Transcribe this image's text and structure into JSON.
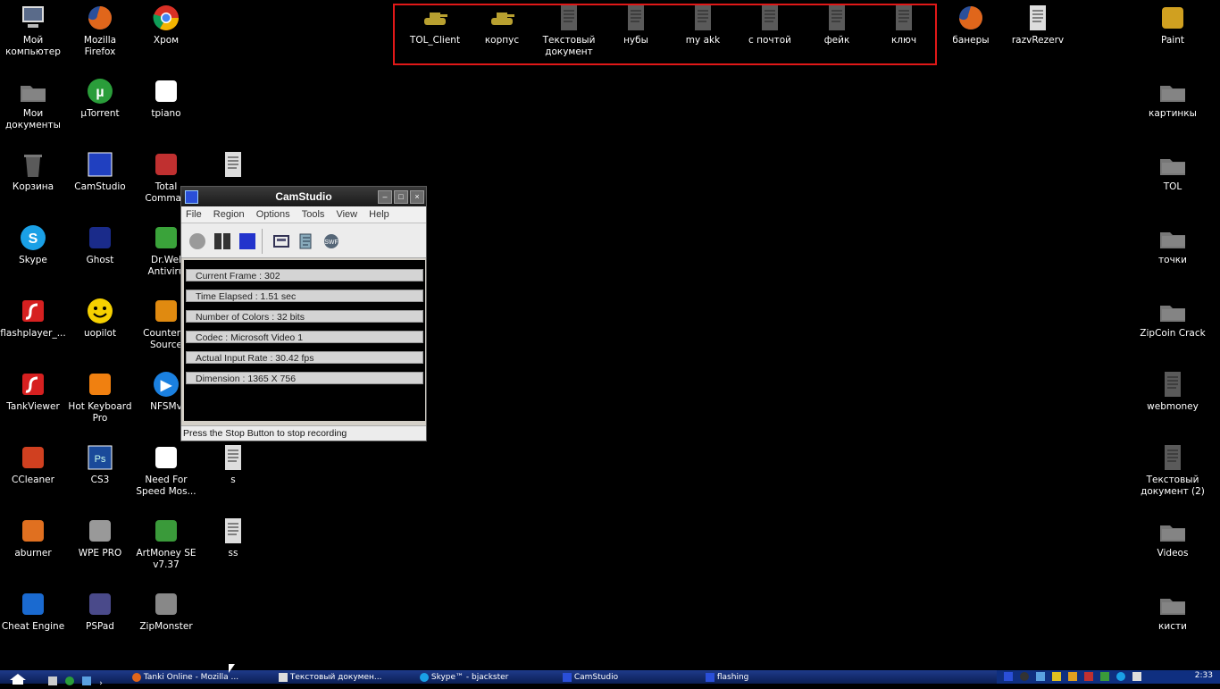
{
  "desktop": {
    "left_icons": [
      {
        "label": "Мой\nкомпьютер",
        "icon": "computer-icon",
        "color": "#5a6b8a"
      },
      {
        "label": "Mozilla Firefox",
        "icon": "firefox-icon",
        "color": "#e0661b"
      },
      {
        "label": "Хром",
        "icon": "chrome-icon",
        "color": "#d93025"
      },
      {
        "label": "Мои\nдокументы",
        "icon": "folder-icon",
        "color": "#777777"
      },
      {
        "label": "µTorrent",
        "icon": "utorrent-icon",
        "color": "#2a9d3a"
      },
      {
        "label": "tpiano",
        "icon": "piano-icon",
        "color": "#ffffff"
      },
      {
        "label": "Корзина",
        "icon": "recycle-bin-icon",
        "color": "#5a5a5a"
      },
      {
        "label": "CamStudio",
        "icon": "camstudio-icon",
        "color": "#2040c0"
      },
      {
        "label": "Total\nComman",
        "icon": "floppy-icon",
        "color": "#c03030"
      },
      {
        "label": "",
        "icon": "document-icon",
        "color": "#dddddd"
      },
      {
        "label": "Skype",
        "icon": "skype-icon",
        "color": "#1aa0e6"
      },
      {
        "label": "Ghost",
        "icon": "ghost-icon",
        "color": "#1a2b8a"
      },
      {
        "label": "Dr.Wel\nAntiviru",
        "icon": "drweb-icon",
        "color": "#3aa33a"
      },
      {
        "label": "flashplayer_...",
        "icon": "flash-icon",
        "color": "#d62020"
      },
      {
        "label": "uopilot",
        "icon": "smiley-icon",
        "color": "#f5d000"
      },
      {
        "label": "Counter-S\nSource",
        "icon": "halflife-icon",
        "color": "#e08a10"
      },
      {
        "label": "TankViewer",
        "icon": "flash-doc-icon",
        "color": "#d62020"
      },
      {
        "label": "Hot Keyboard\nPro",
        "icon": "keyboard-flame-icon",
        "color": "#f08010"
      },
      {
        "label": "NFSMv",
        "icon": "media-player-icon",
        "color": "#1a80e0"
      },
      {
        "label": "CCleaner",
        "icon": "ccleaner-icon",
        "color": "#d04020"
      },
      {
        "label": "CS3",
        "icon": "photoshop-icon",
        "color": "#1a4a9a"
      },
      {
        "label": "Need For\nSpeed Mos...",
        "icon": "nfs-icon",
        "color": "#ffffff"
      },
      {
        "label": "s",
        "icon": "document-icon",
        "color": "#dddddd"
      },
      {
        "label": "aburner",
        "icon": "aburner-icon",
        "color": "#e07020"
      },
      {
        "label": "WPE PRO",
        "icon": "wpe-icon",
        "color": "#999999"
      },
      {
        "label": "ArtMoney SE\nv7.37",
        "icon": "money-icon",
        "color": "#3a9a3a"
      },
      {
        "label": "ss",
        "icon": "document-icon",
        "color": "#dddddd"
      },
      {
        "label": "Cheat Engine",
        "icon": "cheat-engine-icon",
        "color": "#1a6ad0"
      },
      {
        "label": "PSPad",
        "icon": "pspad-icon",
        "color": "#4a4a8a"
      },
      {
        "label": "ZipMonster",
        "icon": "zip-icon",
        "color": "#888888"
      }
    ],
    "top_icons": [
      {
        "label": "TOL_Client",
        "icon": "tank-icon",
        "color": "#b8a030"
      },
      {
        "label": "корпус",
        "icon": "tank-icon",
        "color": "#b8a030"
      },
      {
        "label": "Текстовый\nдокумент",
        "icon": "text-file-icon",
        "color": "#5a5a5a"
      },
      {
        "label": "нубы",
        "icon": "text-file-icon",
        "color": "#5a5a5a"
      },
      {
        "label": "my akk",
        "icon": "text-file-icon",
        "color": "#5a5a5a"
      },
      {
        "label": "с почтой",
        "icon": "text-file-icon",
        "color": "#5a5a5a"
      },
      {
        "label": "фейк",
        "icon": "text-file-icon",
        "color": "#5a5a5a"
      },
      {
        "label": "ключ",
        "icon": "text-file-icon",
        "color": "#5a5a5a"
      },
      {
        "label": "банеры",
        "icon": "firefox-file-icon",
        "color": "#e0661b"
      },
      {
        "label": "razvRezerv",
        "icon": "text-file-icon",
        "color": "#dddddd"
      }
    ],
    "right_icons": [
      {
        "label": "Paint",
        "icon": "paint-icon",
        "color": "#d0a020"
      },
      {
        "label": "картинкы",
        "icon": "folder-icon",
        "color": "#777777"
      },
      {
        "label": "TOL",
        "icon": "folder-icon",
        "color": "#777777"
      },
      {
        "label": "точки",
        "icon": "folder-icon",
        "color": "#777777"
      },
      {
        "label": "ZipCoin Crack",
        "icon": "folder-icon",
        "color": "#777777"
      },
      {
        "label": "webmoney",
        "icon": "text-file-icon",
        "color": "#5a5a5a"
      },
      {
        "label": "Текстовый\nдокумент (2)",
        "icon": "text-file-icon",
        "color": "#5a5a5a"
      },
      {
        "label": "Videos",
        "icon": "folder-icon",
        "color": "#777777"
      },
      {
        "label": "кисти",
        "icon": "folder-icon",
        "color": "#777777"
      }
    ]
  },
  "camstudio": {
    "title": "CamStudio",
    "menu": [
      "File",
      "Region",
      "Options",
      "Tools",
      "View",
      "Help"
    ],
    "stats": [
      "Current Frame : 302",
      "Time Elapsed : 1.51 sec",
      "Number of Colors : 32 bits",
      "Codec : Microsoft Video 1",
      "Actual Input Rate : 30.42 fps",
      "Dimension : 1365 X 756"
    ],
    "status": "Press the Stop Button to stop recording"
  },
  "taskbar": {
    "buttons": [
      "Tanki Online - Mozilla ...",
      "Текстовый докумен...",
      "Skype™ - bjackster",
      "CamStudio",
      "flashing"
    ],
    "clock": "2:33"
  },
  "colors": {
    "highlight": "#e01818",
    "taskbar": "#1e3a8a",
    "camstudio_accent": "#2a4fd8"
  }
}
